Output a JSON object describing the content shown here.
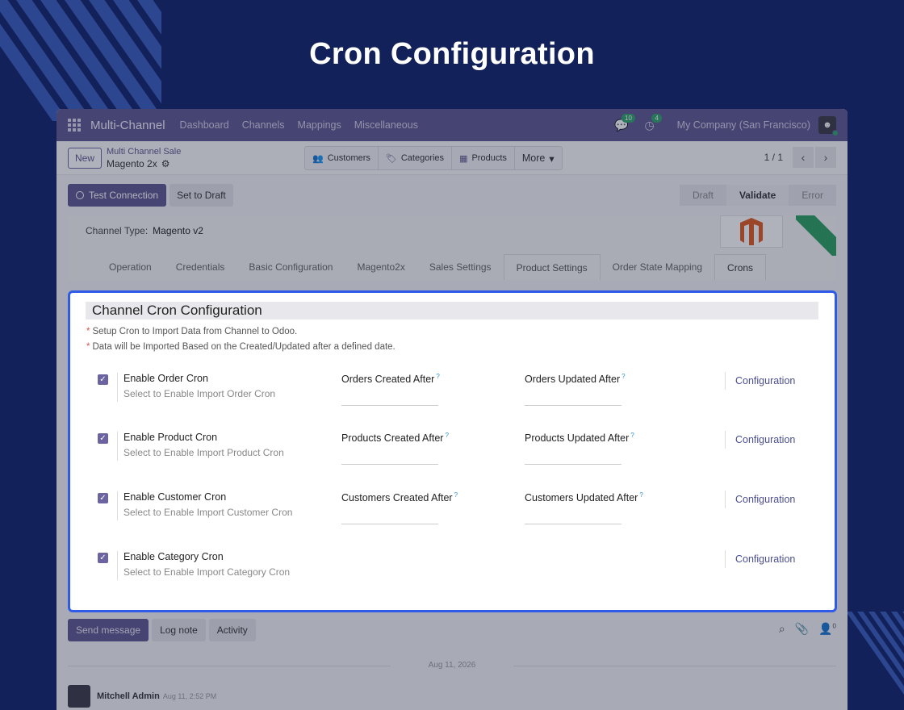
{
  "hero": {
    "title": "Cron Configuration"
  },
  "topnav": {
    "brand": "Multi-Channel",
    "items": [
      "Dashboard",
      "Channels",
      "Mappings",
      "Miscellaneous"
    ],
    "messages_badge": "10",
    "activities_badge": "4",
    "company": "My Company (San Francisco)"
  },
  "controlbar": {
    "new_label": "New",
    "breadcrumb_parent": "Multi Channel Sale",
    "breadcrumb_current": "Magento 2x",
    "smart_buttons": [
      "Customers",
      "Categories",
      "Products",
      "More"
    ],
    "pager": "1 / 1"
  },
  "statusbar": {
    "test_connection": "Test Connection",
    "set_to_draft": "Set to Draft",
    "stages": [
      "Draft",
      "Validate",
      "Error"
    ]
  },
  "sheet": {
    "channel_type_label": "Channel Type:",
    "channel_type_value": "Magento v2",
    "tabs": [
      "Operation",
      "Credentials",
      "Basic Configuration",
      "Magento2x",
      "Sales Settings",
      "Product Settings",
      "Order State Mapping",
      "Crons"
    ]
  },
  "crons": {
    "section_title": "Channel Cron Configuration",
    "notes": [
      "Setup Cron to Import Data from Channel to Odoo.",
      "Data will be Imported Based on the Created/Updated after a defined date."
    ],
    "rows": [
      {
        "label": "Enable Order Cron",
        "help": "Select to Enable Import Order Cron",
        "created": "Orders Created After",
        "updated": "Orders Updated After",
        "config": "Configuration"
      },
      {
        "label": "Enable Product Cron",
        "help": "Select to Enable Import Product Cron",
        "created": "Products Created After",
        "updated": "Products Updated After",
        "config": "Configuration"
      },
      {
        "label": "Enable Customer Cron",
        "help": "Select to Enable Import Customer Cron",
        "created": "Customers Created After",
        "updated": "Customers Updated After",
        "config": "Configuration"
      },
      {
        "label": "Enable Category Cron",
        "help": "Select to Enable Import Category Cron",
        "config": "Configuration"
      }
    ],
    "help_mark": "?"
  },
  "chatter": {
    "send_message": "Send message",
    "log_note": "Log note",
    "activity": "Activity",
    "followers_count": "0",
    "date": "Aug 11, 2026",
    "author": "Mitchell Admin",
    "time": "Aug 11, 2:52 PM"
  }
}
